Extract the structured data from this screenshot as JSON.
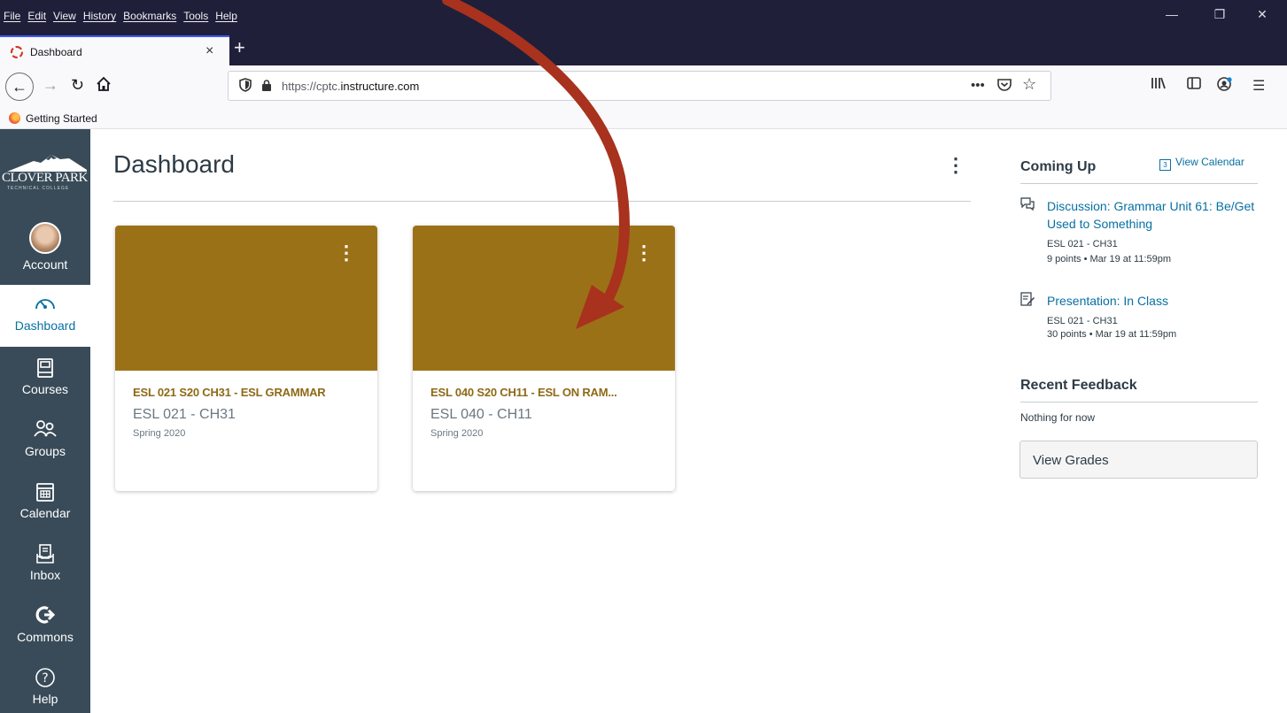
{
  "browser": {
    "menu": [
      "File",
      "Edit",
      "View",
      "History",
      "Bookmarks",
      "Tools",
      "Help"
    ],
    "tab_title": "Dashboard",
    "tab_close": "×",
    "new_tab": "+",
    "url_prefix": "https://cptc.",
    "url_domain": "instructure.com",
    "bookmark": "Getting Started",
    "window_controls": [
      "—",
      "❐",
      "✕"
    ]
  },
  "logo": {
    "name": "CLOVER PARK",
    "sub": "TECHNICAL COLLEGE"
  },
  "globalnav": {
    "account": "Account",
    "dashboard": "Dashboard",
    "courses": "Courses",
    "groups": "Groups",
    "calendar": "Calendar",
    "inbox": "Inbox",
    "commons": "Commons",
    "help": "Help"
  },
  "main": {
    "title": "Dashboard",
    "cards": [
      {
        "title": "ESL 021 S20 CH31 - ESL GRAMMAR",
        "code": "ESL 021 - CH31",
        "term": "Spring 2020",
        "color": "#9b7118"
      },
      {
        "title": "ESL 040 S20 CH11 - ESL ON RAM...",
        "code": "ESL 040 - CH11",
        "term": "Spring 2020",
        "color": "#9b7118"
      }
    ]
  },
  "sidebar": {
    "coming_up": "Coming Up",
    "view_calendar": "View Calendar",
    "calendar_day": "3",
    "items": [
      {
        "title": "Discussion: Grammar Unit 61: Be/Get Used to Something",
        "course": "ESL 021 - CH31",
        "meta": "9 points • Mar 19 at 11:59pm",
        "icon": "discussion-icon"
      },
      {
        "title": "Presentation: In Class",
        "course": "ESL 021 - CH31",
        "meta": "30 points • Mar 19 at 11:59pm",
        "icon": "assignment-icon"
      }
    ],
    "recent_feedback": "Recent Feedback",
    "nothing": "Nothing for now",
    "view_grades": "View Grades"
  },
  "colors": {
    "nav": "#394b58",
    "link": "#0770a3",
    "card": "#9b7118",
    "arrow": "#a8321d"
  }
}
